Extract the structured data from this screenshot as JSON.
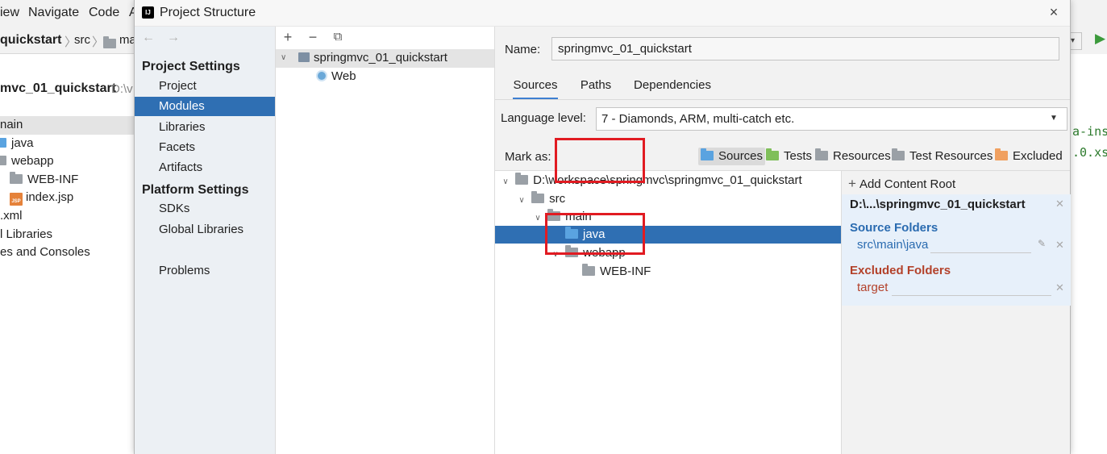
{
  "background_ide": {
    "menu": [
      "iew",
      "Navigate",
      "Code",
      "A"
    ],
    "breadcrumb": [
      "quickstart",
      "src",
      "ma"
    ],
    "project_label": "mvc_01_quickstart",
    "project_path_hint": "D:\\v",
    "tree": [
      {
        "label": "nain",
        "icon": "none"
      },
      {
        "label": "java",
        "icon": "folder-icon"
      },
      {
        "label": "webapp",
        "icon": "folder-icon"
      },
      {
        "label": "WEB-INF",
        "icon": "folder-icon"
      },
      {
        "label": "index.jsp",
        "icon": "jsp-file-icon"
      },
      {
        "label": ".xml",
        "icon": "none"
      },
      {
        "label": "l Libraries",
        "icon": "none"
      },
      {
        "label": "es and Consoles",
        "icon": "none"
      }
    ],
    "code_fragments": [
      "a-ins",
      ".0.xs"
    ]
  },
  "dialog": {
    "title": "Project Structure",
    "close_symbol": "×",
    "nav": {
      "back_symbol": "←",
      "forward_symbol": "→",
      "project_settings_header": "Project Settings",
      "project_settings_items": [
        "Project",
        "Modules",
        "Libraries",
        "Facets",
        "Artifacts"
      ],
      "selected_item": "Modules",
      "platform_settings_header": "Platform Settings",
      "platform_settings_items": [
        "SDKs",
        "Global Libraries"
      ],
      "problems": "Problems"
    },
    "modules": {
      "toolbar": {
        "add": "+",
        "remove": "−",
        "copy": "⧉"
      },
      "module_name": "springmvc_01_quickstart",
      "facet": "Web"
    },
    "content": {
      "name_label": "Name:",
      "name_value": "springmvc_01_quickstart",
      "tabs": [
        "Sources",
        "Paths",
        "Dependencies"
      ],
      "active_tab": "Sources",
      "language_level_label": "Language level:",
      "language_level_value": "7 - Diamonds, ARM, multi-catch etc.",
      "mark_as_label": "Mark as:",
      "mark_buttons": [
        "Sources",
        "Tests",
        "Resources",
        "Test Resources",
        "Excluded"
      ],
      "tree": {
        "root": "D:\\workspace\\springmvc\\springmvc_01_quickstart",
        "src": "src",
        "main": "main",
        "java": "java",
        "webapp": "webapp",
        "webinf": "WEB-INF"
      },
      "roots": {
        "add_content_root": "Add Content Root",
        "content_root": "D:\\...\\springmvc_01_quickstart",
        "source_folders_title": "Source Folders",
        "source_folder": "src\\main\\java",
        "excluded_folders_title": "Excluded Folders",
        "excluded_folder": "target"
      }
    }
  },
  "colors": {
    "selection": "#2f6fb3",
    "source_folder_blue": "#5aa3e0",
    "tests_green": "#7fbf5a",
    "excluded_orange": "#f0a060",
    "source_title": "#2a6bb0",
    "excluded_title": "#b3412a",
    "annotation_red": "#e11b22"
  }
}
